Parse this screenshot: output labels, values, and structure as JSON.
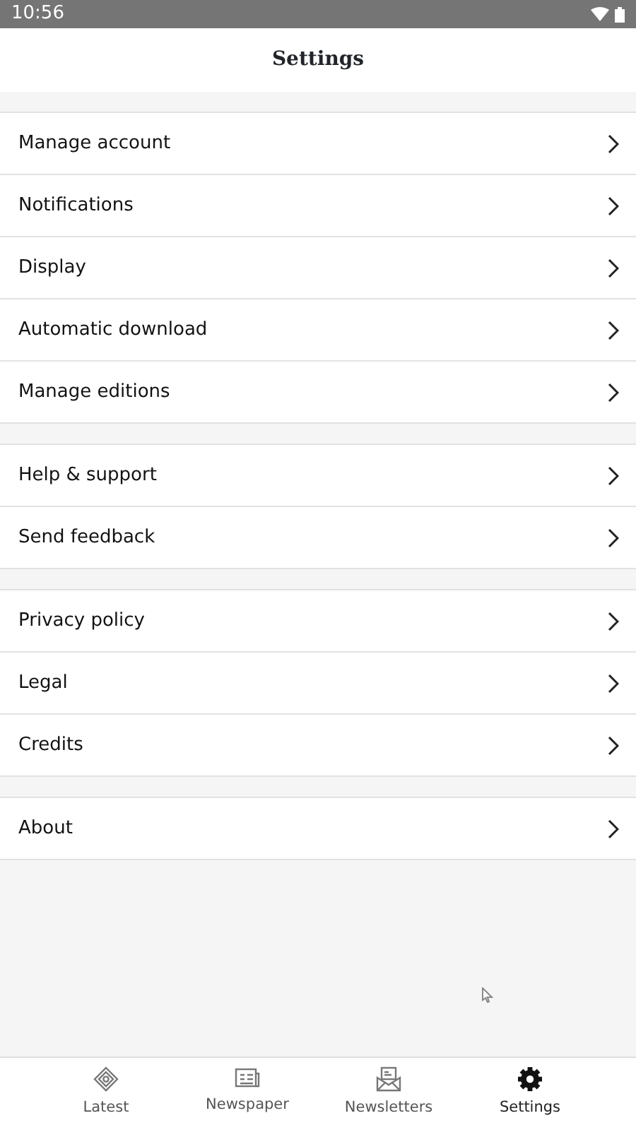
{
  "status_bar": {
    "time": "10:56"
  },
  "header": {
    "title": "Settings"
  },
  "groups": [
    {
      "items": [
        {
          "label": "Manage account"
        },
        {
          "label": "Notifications"
        },
        {
          "label": "Display"
        },
        {
          "label": "Automatic download"
        },
        {
          "label": "Manage editions"
        }
      ]
    },
    {
      "items": [
        {
          "label": "Help & support"
        },
        {
          "label": "Send feedback"
        }
      ]
    },
    {
      "items": [
        {
          "label": "Privacy policy"
        },
        {
          "label": "Legal"
        },
        {
          "label": "Credits"
        }
      ]
    },
    {
      "items": [
        {
          "label": "About"
        }
      ]
    }
  ],
  "bottom_nav": [
    {
      "label": "Latest",
      "kind": "diamond",
      "selected": false
    },
    {
      "label": "Newspaper",
      "kind": "newspaper",
      "selected": false
    },
    {
      "label": "Newsletters",
      "kind": "envelope",
      "selected": false
    },
    {
      "label": "Settings",
      "kind": "gear",
      "selected": true
    }
  ]
}
